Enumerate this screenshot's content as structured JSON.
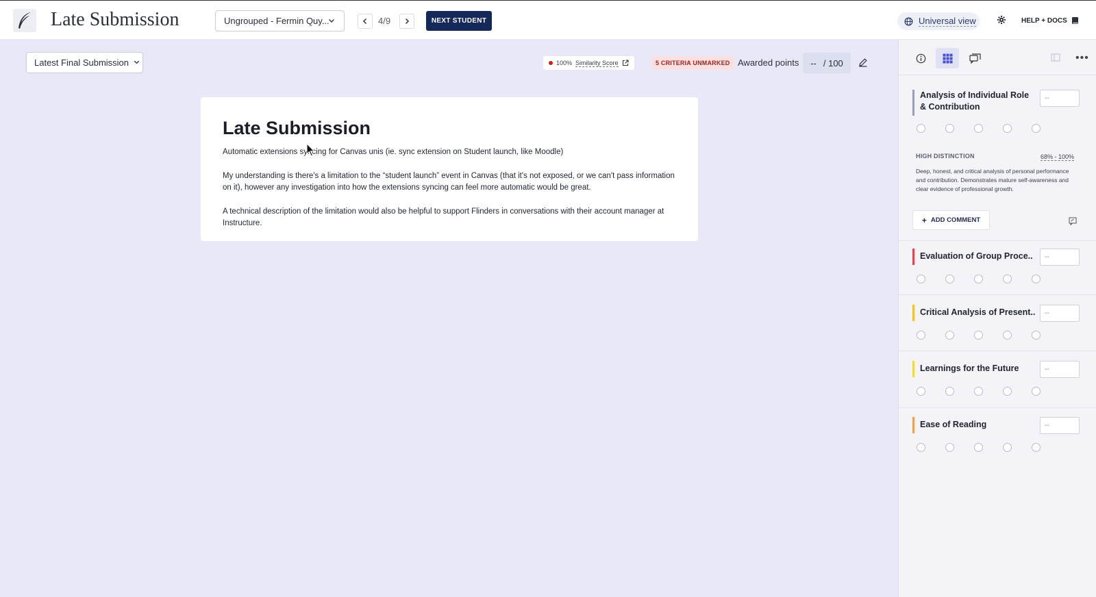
{
  "header": {
    "app_title": "Late Submission",
    "student_select": "Ungrouped - Fermin Quy...",
    "counter": "4/9",
    "next_student": "NEXT STUDENT",
    "view_label": "Universal view",
    "help_label": "HELP + DOCS"
  },
  "toolbar": {
    "version_select": "Latest Final Submission",
    "similarity_percent": "100%",
    "similarity_label": "Similarity Score",
    "unmarked_badge": "5 CRITERIA UNMARKED",
    "awarded_label": "Awarded points",
    "points_value": "--",
    "points_total": "/ 100"
  },
  "document": {
    "title": "Late Submission",
    "paragraphs": [
      "Automatic extensions syncing for Canvas unis (ie. sync extension on Student launch, like Moodle)",
      "My understanding is there's a limitation to the “student launch” event in Canvas (that it's not exposed, or we can't pass information on it), however any investigation into how the extensions syncing can feel more automatic would be great.",
      "A technical description of the limitation would also be helpful to support Flinders in conversations with their account manager at Instructure."
    ]
  },
  "rubric": {
    "score_placeholder": "--",
    "criteria": [
      {
        "title": "Analysis of Individual Role & Contribution",
        "color": "#9aa0b4"
      },
      {
        "title": "Evaluation of Group Proce..",
        "color": "#e0474c"
      },
      {
        "title": "Critical Analysis of Present..",
        "color": "#f2c037"
      },
      {
        "title": "Learnings for the Future",
        "color": "#f4d84a"
      },
      {
        "title": "Ease of Reading",
        "color": "#f0a05a"
      }
    ],
    "expanded_level": {
      "name": "HIGH DISTINCTION",
      "range": "68% - 100%",
      "description": "Deep, honest, and critical analysis of personal performance and contribution. Demonstrates mature self-awareness and clear evidence of professional growth."
    },
    "add_comment": "ADD COMMENT"
  }
}
